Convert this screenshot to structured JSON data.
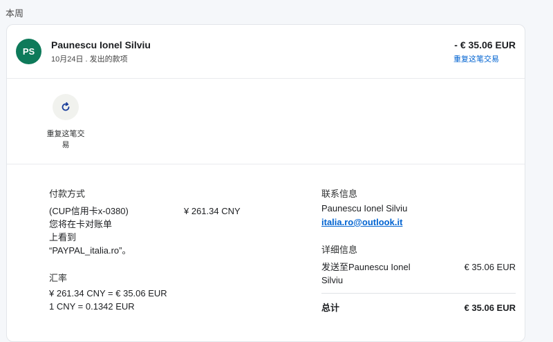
{
  "section_label": "本周",
  "transaction": {
    "avatar_initials": "PS",
    "avatar_color": "#0e7a5a",
    "name": "Paunescu Ionel Silviu",
    "subline": "10月24日 . 发出的款项",
    "amount": "- € 35.06 EUR",
    "repeat_link": "重复这笔交易"
  },
  "actions": {
    "repeat_icon": "refresh-icon",
    "repeat_label": "重复这笔交易"
  },
  "payment": {
    "heading": "付款方式",
    "method": "(CUP信用卡x-0380)",
    "amount": "¥ 261.34 CNY",
    "statement_lines": [
      "您将在卡对账单",
      "上看到",
      "“PAYPAL_italia.ro”。"
    ]
  },
  "exchange": {
    "heading": "汇率",
    "line1": "¥ 261.34 CNY = € 35.06 EUR",
    "line2": "1 CNY = 0.1342 EUR"
  },
  "contact": {
    "heading": "联系信息",
    "name": "Paunescu Ionel Silviu",
    "email": "italia.ro@outlook.it"
  },
  "details": {
    "heading": "详细信息",
    "sent_to_lines": [
      "发送至Paunescu Ionel",
      "Silviu"
    ],
    "sent_amount": "€ 35.06 EUR",
    "total_label": "总计",
    "total_amount": "€ 35.06 EUR"
  }
}
